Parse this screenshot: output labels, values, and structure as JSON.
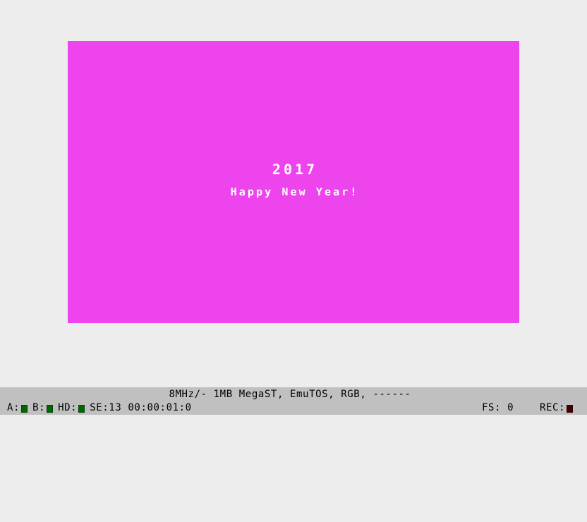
{
  "window": {
    "background_color": "#ededed"
  },
  "emulated_screen": {
    "background_color": "#ee44ee",
    "text_color": "#ffffff",
    "lines": {
      "year": "2017",
      "greeting": "Happy New Year!"
    }
  },
  "status_bar": {
    "background_color": "#c0c0c0",
    "machine_info": "8MHz/- 1MB MegaST, EmuTOS, RGB, ------",
    "drives": [
      {
        "label": "A:",
        "led_state": "off",
        "led_color": "#006600"
      },
      {
        "label": "B:",
        "led_state": "off",
        "led_color": "#006600"
      },
      {
        "label": "HD:",
        "led_state": "off",
        "led_color": "#006600"
      }
    ],
    "session": "SE:13 00:00:01:0",
    "frameskip": "FS: 0",
    "record": {
      "label": "REC:",
      "led_state": "off",
      "led_color": "#440000"
    }
  }
}
